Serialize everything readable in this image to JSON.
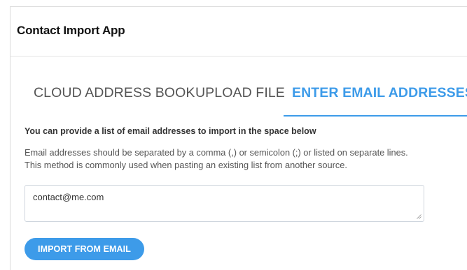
{
  "app": {
    "title": "Contact Import App"
  },
  "tabs": [
    {
      "label": "CLOUD ADDRESS BOOK",
      "active": false
    },
    {
      "label": "UPLOAD FILE",
      "active": false
    },
    {
      "label": "ENTER EMAIL ADDRESSES",
      "active": true
    }
  ],
  "enter_emails": {
    "intro": "You can provide a list of email addresses to import in the space below",
    "help_line_1": "Email addresses should be separated by a comma (,) or semicolon (;) or listed on separate lines.",
    "help_line_2": "This method is commonly used when pasting an existing list from another source.",
    "textarea_value": "contact@me.com",
    "import_button_label": "IMPORT FROM EMAIL"
  },
  "colors": {
    "accent": "#3d9be9",
    "text": "#222222",
    "muted": "#555555",
    "border": "#dcdcdc"
  }
}
